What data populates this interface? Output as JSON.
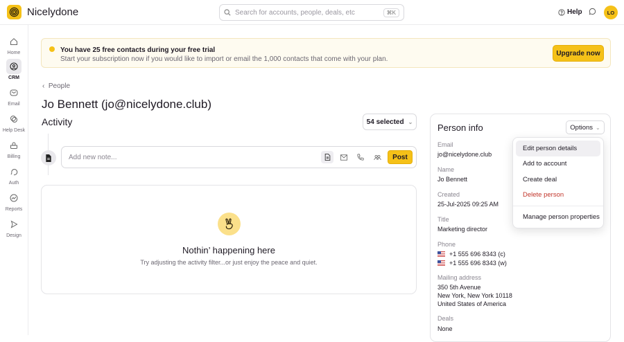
{
  "app": {
    "brand": "Nicelydone",
    "search_placeholder": "Search for accounts, people, deals, etc",
    "search_shortcut": "⌘K",
    "help": "Help",
    "avatar": "LO"
  },
  "sidebar": {
    "items": [
      {
        "label": "Home"
      },
      {
        "label": "CRM",
        "active": true
      },
      {
        "label": "Email"
      },
      {
        "label": "Help Desk"
      },
      {
        "label": "Billing"
      },
      {
        "label": "Auth"
      },
      {
        "label": "Reports"
      },
      {
        "label": "Design"
      }
    ]
  },
  "banner": {
    "title": "You have 25 free contacts during your free trial",
    "text": "Start your subscription now if you would like to import or email the 1,000 contacts that come with your plan.",
    "button": "Upgrade now"
  },
  "breadcrumb": "People",
  "page_title": "Jo Bennett (jo@nicelydone.club)",
  "activity": {
    "title": "Activity",
    "filter": "54 selected",
    "note_placeholder": "Add new note...",
    "post": "Post",
    "empty_title": "Nothin’ happening here",
    "empty_text": "Try adjusting the activity filter...or just enjoy the peace and quiet."
  },
  "person": {
    "title": "Person info",
    "options": "Options",
    "email_label": "Email",
    "email": "jo@nicelydone.club",
    "name_label": "Name",
    "name": "Jo Bennett",
    "created_label": "Created",
    "created": "25-Jul-2025 09:25 AM",
    "title_label": "Title",
    "title_value": "Marketing director",
    "phone_label": "Phone",
    "phones": [
      "+1 555 696 8343 (c)",
      "+1 555 696 8343 (w)"
    ],
    "address_label": "Mailing address",
    "address": [
      "350 5th Avenue",
      "New York, New York  10118",
      "United States of America"
    ],
    "deals_label": "Deals",
    "deals": "None"
  },
  "menu": {
    "items": [
      "Edit person details",
      "Add to account",
      "Create deal",
      "Delete person",
      "Manage person properties"
    ]
  }
}
